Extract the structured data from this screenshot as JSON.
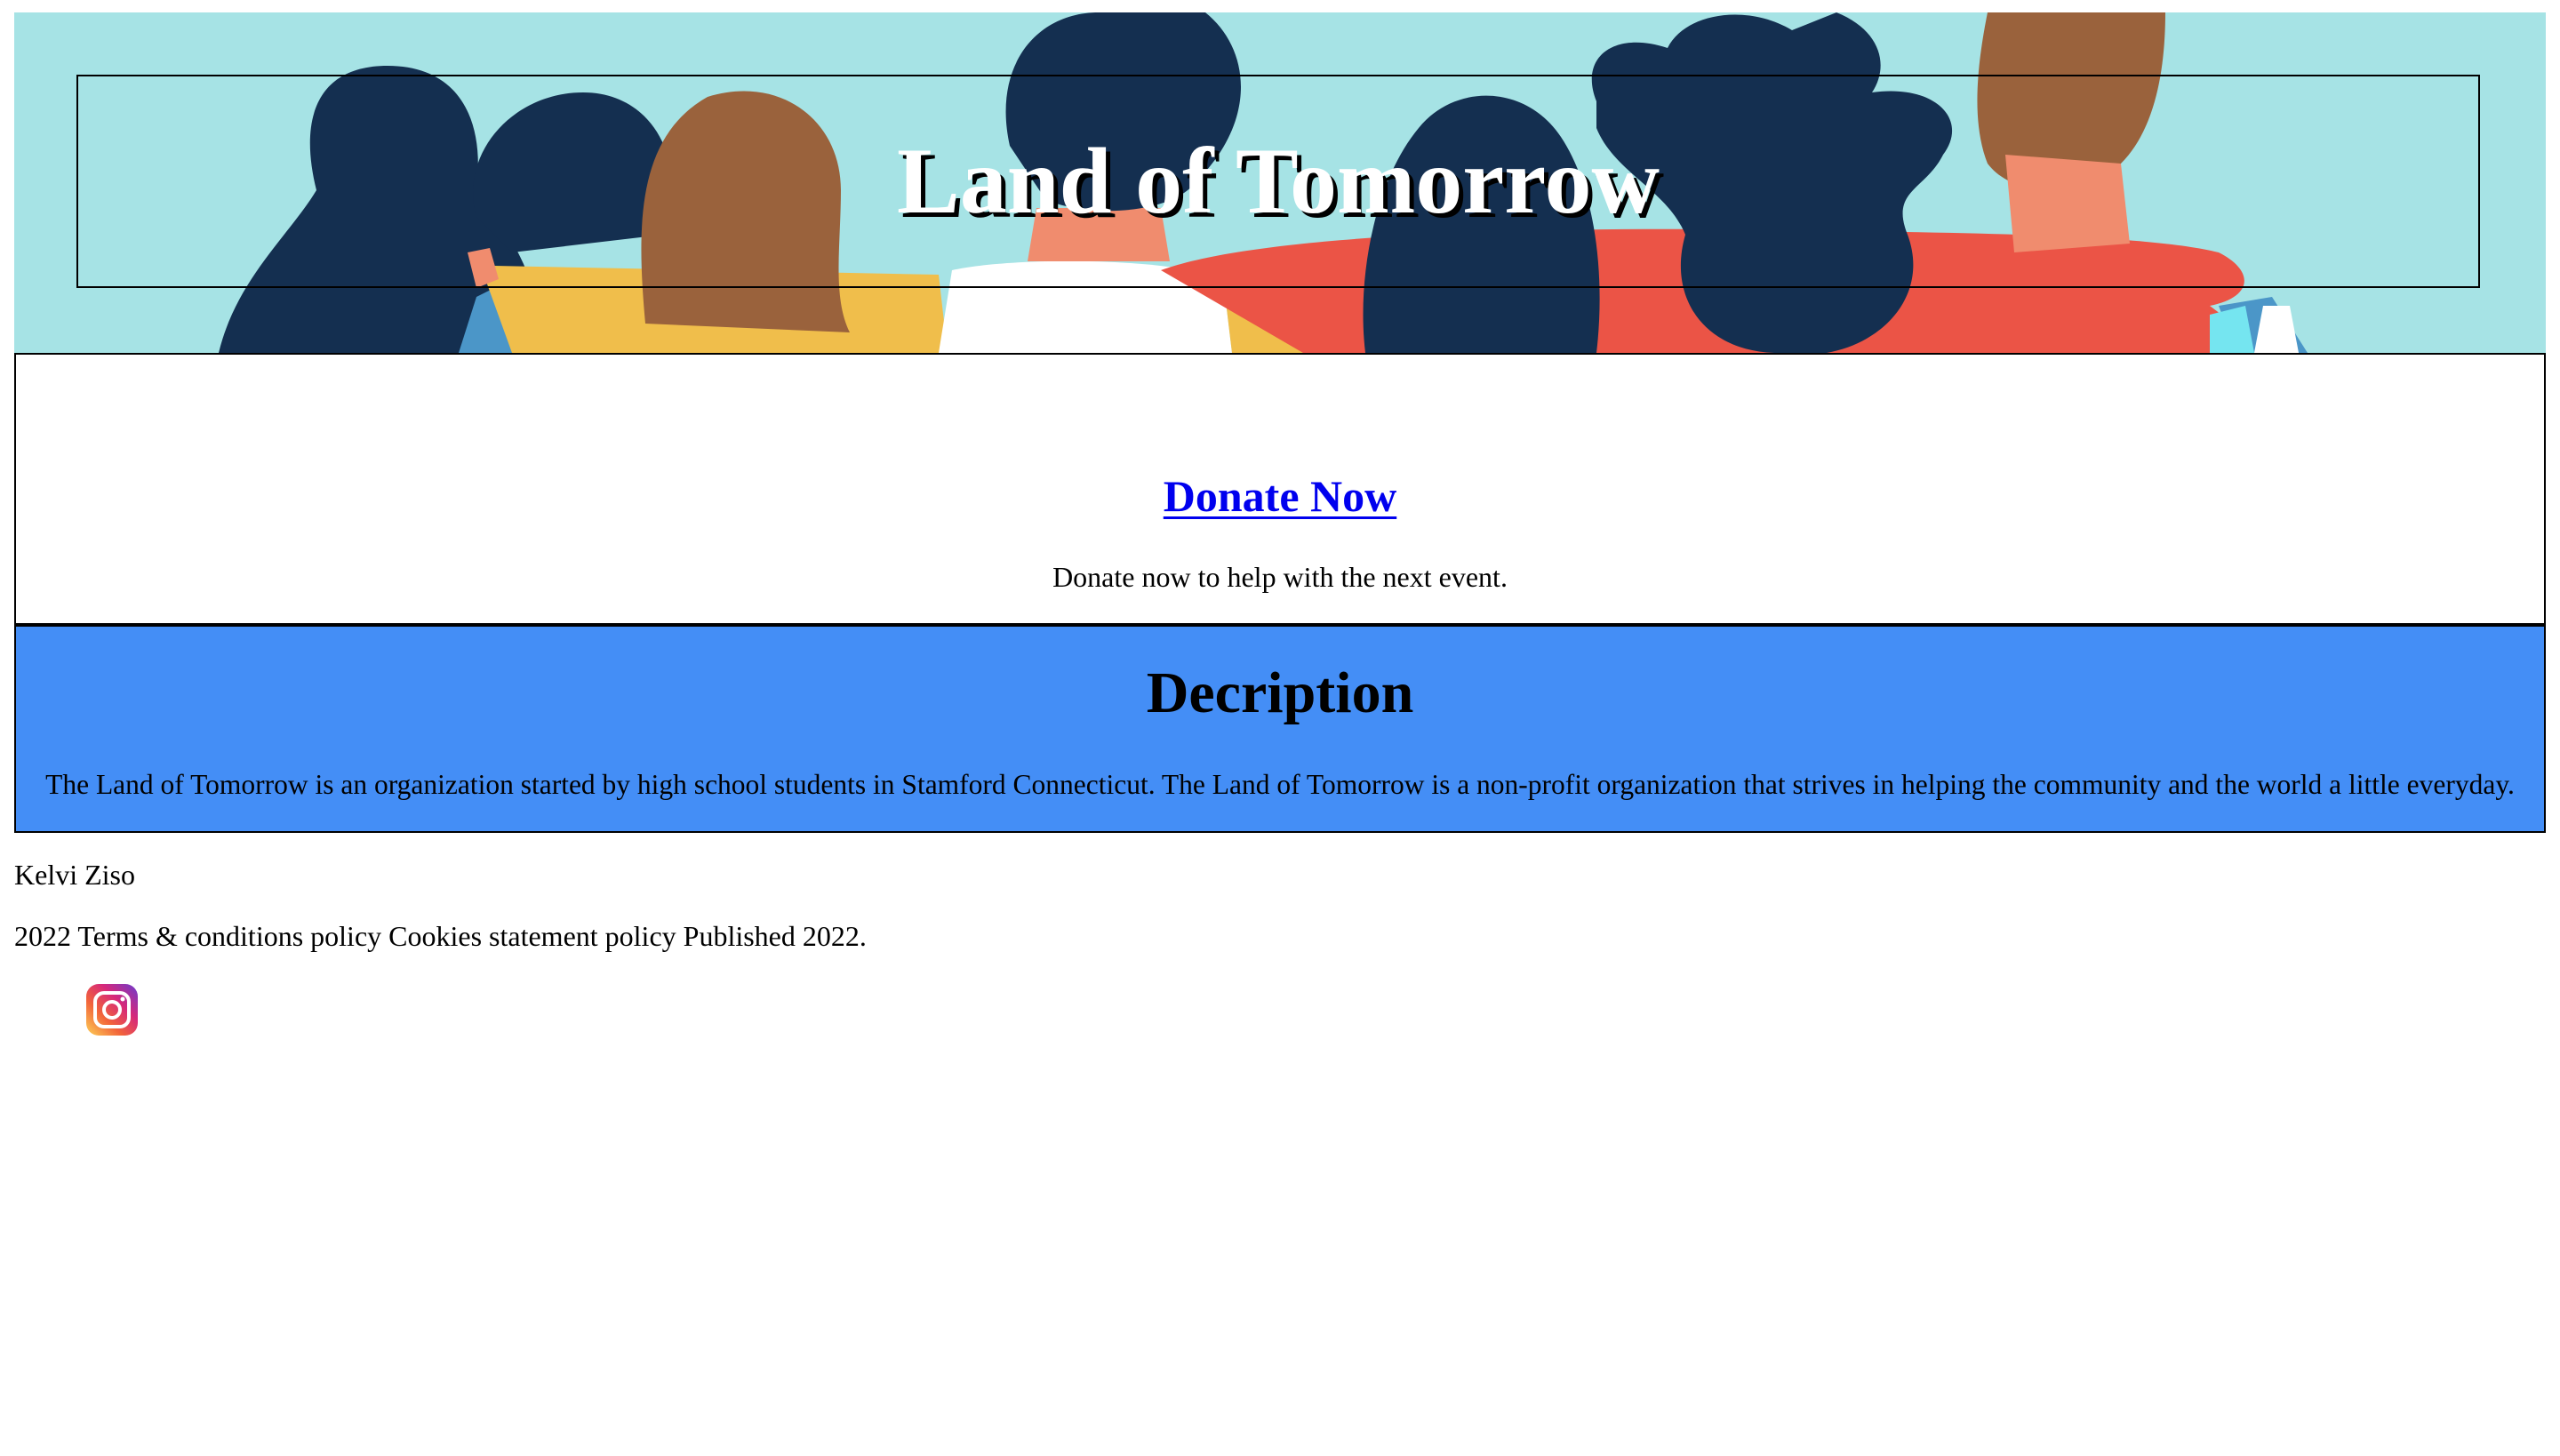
{
  "header": {
    "title": "Land of Tomorrow",
    "background_color": "#a6e3e5"
  },
  "donate": {
    "link_label": "Donate Now",
    "text": "Donate now to help with the next event.",
    "link_color": "#0000ee"
  },
  "description": {
    "heading": "Decription",
    "text": "The Land of Tomorrow is an organization started by high school students in Stamford Connecticut. The Land of Tomorrow is a non-profit organization that strives in helping the community and the world a little everyday.",
    "background_color": "#448ef6"
  },
  "footer": {
    "author": "Kelvi Ziso",
    "legal": "2022 Terms & conditions policy Cookies statement policy Published 2022.",
    "social_icon": "instagram-icon"
  }
}
